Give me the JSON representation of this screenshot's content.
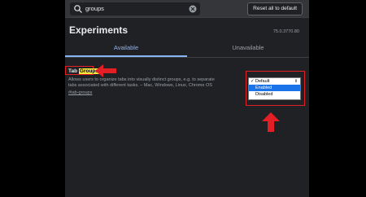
{
  "search": {
    "query": "groups"
  },
  "toolbar": {
    "reset_label": "Reset all to default"
  },
  "page": {
    "title": "Experiments",
    "version": "75.0.3770.80"
  },
  "tabs": [
    {
      "label": "Available"
    },
    {
      "label": "Unavailable"
    }
  ],
  "experiment": {
    "title_prefix": "Tab",
    "title_highlight": "Groups",
    "description": "Allows users to organize tabs into visually distinct groups, e.g. to separate tabs associated with different tasks. – Mac, Windows, Linux, Chrome OS",
    "link": "#tab-groups",
    "options": [
      {
        "label": "Default",
        "checked": true
      },
      {
        "label": "Enabled",
        "selected": true
      },
      {
        "label": "Disabled"
      }
    ]
  },
  "colors": {
    "accent": "#8ab4f8",
    "annotation": "#e31e24",
    "highlight": "#ffeb3b",
    "selection": "#1a73e8"
  }
}
